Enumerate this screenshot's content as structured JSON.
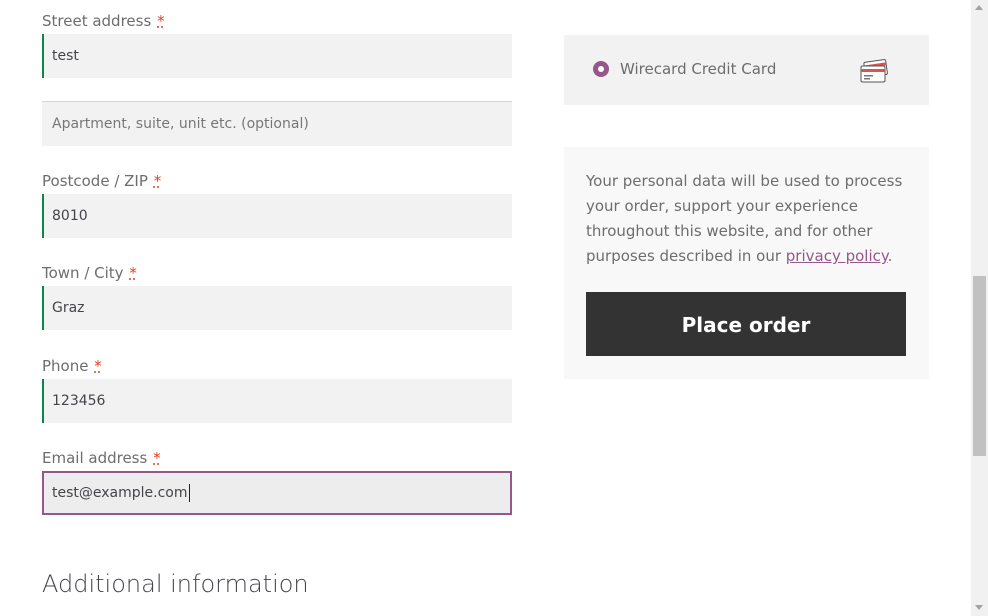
{
  "billing": {
    "street": {
      "label": "Street address",
      "required_mark": "*",
      "value": "test"
    },
    "apartment": {
      "placeholder": "Apartment, suite, unit etc. (optional)"
    },
    "postcode": {
      "label": "Postcode / ZIP",
      "required_mark": "*",
      "value": "8010"
    },
    "city": {
      "label": "Town / City",
      "required_mark": "*",
      "value": "Graz"
    },
    "phone": {
      "label": "Phone",
      "required_mark": "*",
      "value": "123456"
    },
    "email": {
      "label": "Email address",
      "required_mark": "*",
      "value": "test@example.com"
    }
  },
  "additional": {
    "title": "Additional information"
  },
  "payment": {
    "method_label": "Wirecard Credit Card",
    "icon": "credit-card-icon",
    "selected": true
  },
  "privacy": {
    "text_before": "Your personal data will be used to process your order, support your experience throughout this website, and for other purposes described in our ",
    "link_label": "privacy policy",
    "text_after": "."
  },
  "place_order_label": "Place order",
  "colors": {
    "accent": "#96588a",
    "valid": "#0f834d",
    "required": "#e2401c",
    "button_bg": "#333333"
  }
}
